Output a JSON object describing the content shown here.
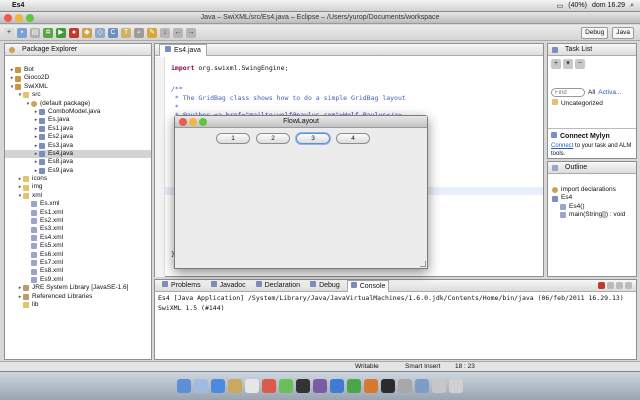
{
  "menubar": {
    "app": "Es4",
    "status_text": "(40%)",
    "clock": "dom 16.29"
  },
  "window": {
    "title": "Java – SwiXML/src/Es4.java – Eclipse – /Users/yurop/Documents/workspace"
  },
  "perspectives": [
    "Debug",
    "Java"
  ],
  "package_explorer": {
    "title": "Package Explorer",
    "tree": [
      {
        "label": "Bot",
        "indent": 0,
        "icon": "proj",
        "arrow": "▸"
      },
      {
        "label": "Gioco2D",
        "indent": 0,
        "icon": "proj",
        "arrow": "▸"
      },
      {
        "label": "SwiXML",
        "indent": 0,
        "icon": "proj",
        "arrow": "▾"
      },
      {
        "label": "src",
        "indent": 1,
        "icon": "fold",
        "arrow": "▾"
      },
      {
        "label": "(default package)",
        "indent": 2,
        "icon": "pkg",
        "arrow": "▾"
      },
      {
        "label": "ComboModel.java",
        "indent": 3,
        "icon": "java",
        "arrow": "▸"
      },
      {
        "label": "Es.java",
        "indent": 3,
        "icon": "java",
        "arrow": "▸"
      },
      {
        "label": "Es1.java",
        "indent": 3,
        "icon": "java",
        "arrow": "▸"
      },
      {
        "label": "Es2.java",
        "indent": 3,
        "icon": "java",
        "arrow": "▸"
      },
      {
        "label": "Es3.java",
        "indent": 3,
        "icon": "java",
        "arrow": "▸"
      },
      {
        "label": "Es4.java",
        "indent": 3,
        "icon": "java",
        "arrow": "▸",
        "selected": true
      },
      {
        "label": "Es8.java",
        "indent": 3,
        "icon": "java",
        "arrow": "▸"
      },
      {
        "label": "Es9.java",
        "indent": 3,
        "icon": "java",
        "arrow": "▸"
      },
      {
        "label": "icons",
        "indent": 1,
        "icon": "fold",
        "arrow": "▸"
      },
      {
        "label": "img",
        "indent": 1,
        "icon": "fold",
        "arrow": "▸"
      },
      {
        "label": "xml",
        "indent": 1,
        "icon": "fold",
        "arrow": "▾"
      },
      {
        "label": "Es.xml",
        "indent": 2,
        "icon": "xml",
        "arrow": ""
      },
      {
        "label": "Es1.xml",
        "indent": 2,
        "icon": "xml",
        "arrow": ""
      },
      {
        "label": "Es2.xml",
        "indent": 2,
        "icon": "xml",
        "arrow": ""
      },
      {
        "label": "Es3.xml",
        "indent": 2,
        "icon": "xml",
        "arrow": ""
      },
      {
        "label": "Es4.xml",
        "indent": 2,
        "icon": "xml",
        "arrow": ""
      },
      {
        "label": "Es5.xml",
        "indent": 2,
        "icon": "xml",
        "arrow": ""
      },
      {
        "label": "Es6.xml",
        "indent": 2,
        "icon": "xml",
        "arrow": ""
      },
      {
        "label": "Es7.xml",
        "indent": 2,
        "icon": "xml",
        "arrow": ""
      },
      {
        "label": "Es8.xml",
        "indent": 2,
        "icon": "xml",
        "arrow": ""
      },
      {
        "label": "Es9.xml",
        "indent": 2,
        "icon": "xml",
        "arrow": ""
      },
      {
        "label": "JRE System Library [JavaSE-1.6]",
        "indent": 1,
        "icon": "lib",
        "arrow": "▸"
      },
      {
        "label": "Referenced Libraries",
        "indent": 1,
        "icon": "lib",
        "arrow": "▸"
      },
      {
        "label": "lib",
        "indent": 1,
        "icon": "fold",
        "arrow": ""
      }
    ]
  },
  "editor": {
    "tab": "Es4.java",
    "import_kw": "import",
    "import_rest": " org.swixml.SwingEngine;",
    "comment_open": "/**",
    "comment_line1": " * The GridBag class shows how to do a simple GridBag layout",
    "comment_line2": " *",
    "author_tag": " * @author ",
    "author_link": "<a href=\"mailto:wolf@paulus.com\">Wolf Paulus</a>",
    "brace": "}"
  },
  "flow_window": {
    "title": "FlowLayout",
    "buttons": [
      "1",
      "2",
      "3",
      "4"
    ],
    "focused_index": 2
  },
  "task_list": {
    "title": "Task List",
    "find_placeholder": "Find",
    "all_label": "All",
    "activate_label": "Activa...",
    "category": "Uncategorized"
  },
  "mylyn": {
    "title": "Connect Mylyn",
    "link": "Connect",
    "text": " to your task and ALM tools."
  },
  "outline": {
    "title": "Outline",
    "items": [
      {
        "label": "import declarations",
        "indent": 0
      },
      {
        "label": "Es4",
        "indent": 0
      },
      {
        "label": "Es4()",
        "indent": 1
      },
      {
        "label": "main(String[]) : void",
        "indent": 1
      }
    ]
  },
  "bottom": {
    "tabs": [
      "Problems",
      "Javadoc",
      "Declaration",
      "Debug",
      "Console"
    ],
    "active_tab": "Console",
    "header": "Es4 [Java Application] /System/Library/Java/JavaVirtualMachines/1.6.0.jdk/Contents/Home/bin/java (06/feb/2011 16.29.13)",
    "output": "SwiXML 1.5 (#144)"
  },
  "status": {
    "writable": "Writable",
    "insert": "Smart Insert",
    "position": "18 : 23"
  },
  "colors": {
    "accent": "#5b8fd6",
    "close": "#ee5a52",
    "minimize": "#f2b73a",
    "zoom": "#5fc440"
  }
}
